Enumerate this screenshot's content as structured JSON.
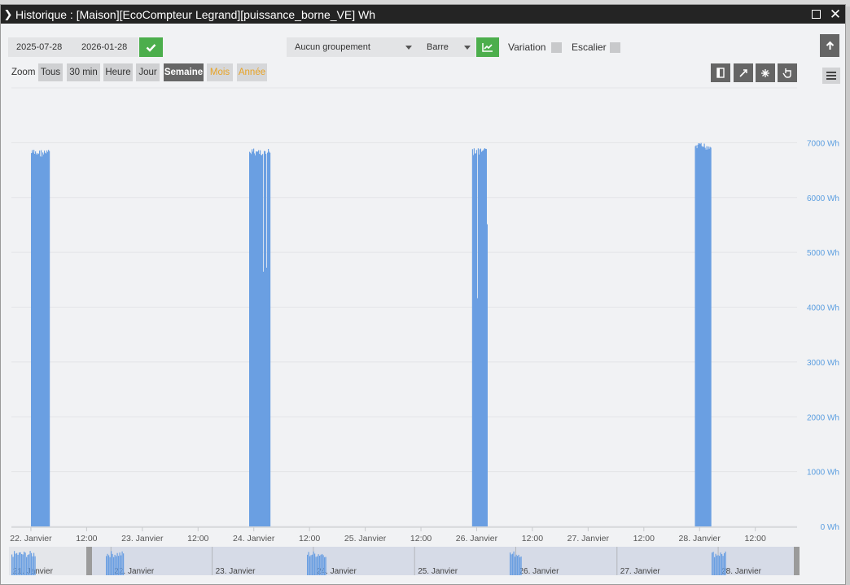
{
  "window": {
    "title": "Historique : [Maison][EcoCompteur Legrand][puissance_borne_VE] Wh"
  },
  "toolbar": {
    "date_start": "2025-07-28",
    "date_end": "2026-01-28",
    "grouping": "Aucun groupement",
    "chart_type": "Barre",
    "variation_label": "Variation",
    "escalier_label": "Escalier",
    "zoom_label": "Zoom",
    "zoom_buttons": [
      "Tous",
      "30 min",
      "Heure",
      "Jour",
      "Semaine",
      "Mois",
      "Année"
    ],
    "zoom_active": "Semaine"
  },
  "colors": {
    "series": "#6a9fe2",
    "axis_label": "#5b9ee0",
    "confirm": "#4cae4c",
    "active_zoom": "#666666",
    "disabled_zoom": "#e8a325"
  },
  "chart_data": {
    "type": "bar",
    "unit": "Wh",
    "ylim": [
      0,
      7000
    ],
    "y_ticks": [
      "0 Wh",
      "1000 Wh",
      "2000 Wh",
      "3000 Wh",
      "4000 Wh",
      "5000 Wh",
      "6000 Wh",
      "7000 Wh"
    ],
    "x_ticks": [
      "22. Janvier",
      "12:00",
      "23. Janvier",
      "12:00",
      "24. Janvier",
      "12:00",
      "25. Janvier",
      "12:00",
      "26. Janvier",
      "12:00",
      "27. Janvier",
      "12:00",
      "28. Janvier",
      "12:00"
    ],
    "x_range_hours": [
      -4.2,
      165.0
    ],
    "grid": true,
    "sessions": [
      {
        "start_h": 0.0,
        "end_h": 4.0,
        "value": 6880
      },
      {
        "start_h": 47.0,
        "end_h": 51.5,
        "value": 6900
      },
      {
        "start_h": 95.0,
        "end_h": 98.2,
        "value": 6900
      },
      {
        "start_h": 143.0,
        "end_h": 146.5,
        "value": 7000
      }
    ],
    "navigator": {
      "ticks": [
        "21. Janvier",
        "22. Janvier",
        "23. Janvier",
        "24. Janvier",
        "25. Janvier",
        "26. Janvier",
        "27. Janvier",
        "28. Janvier"
      ]
    }
  }
}
